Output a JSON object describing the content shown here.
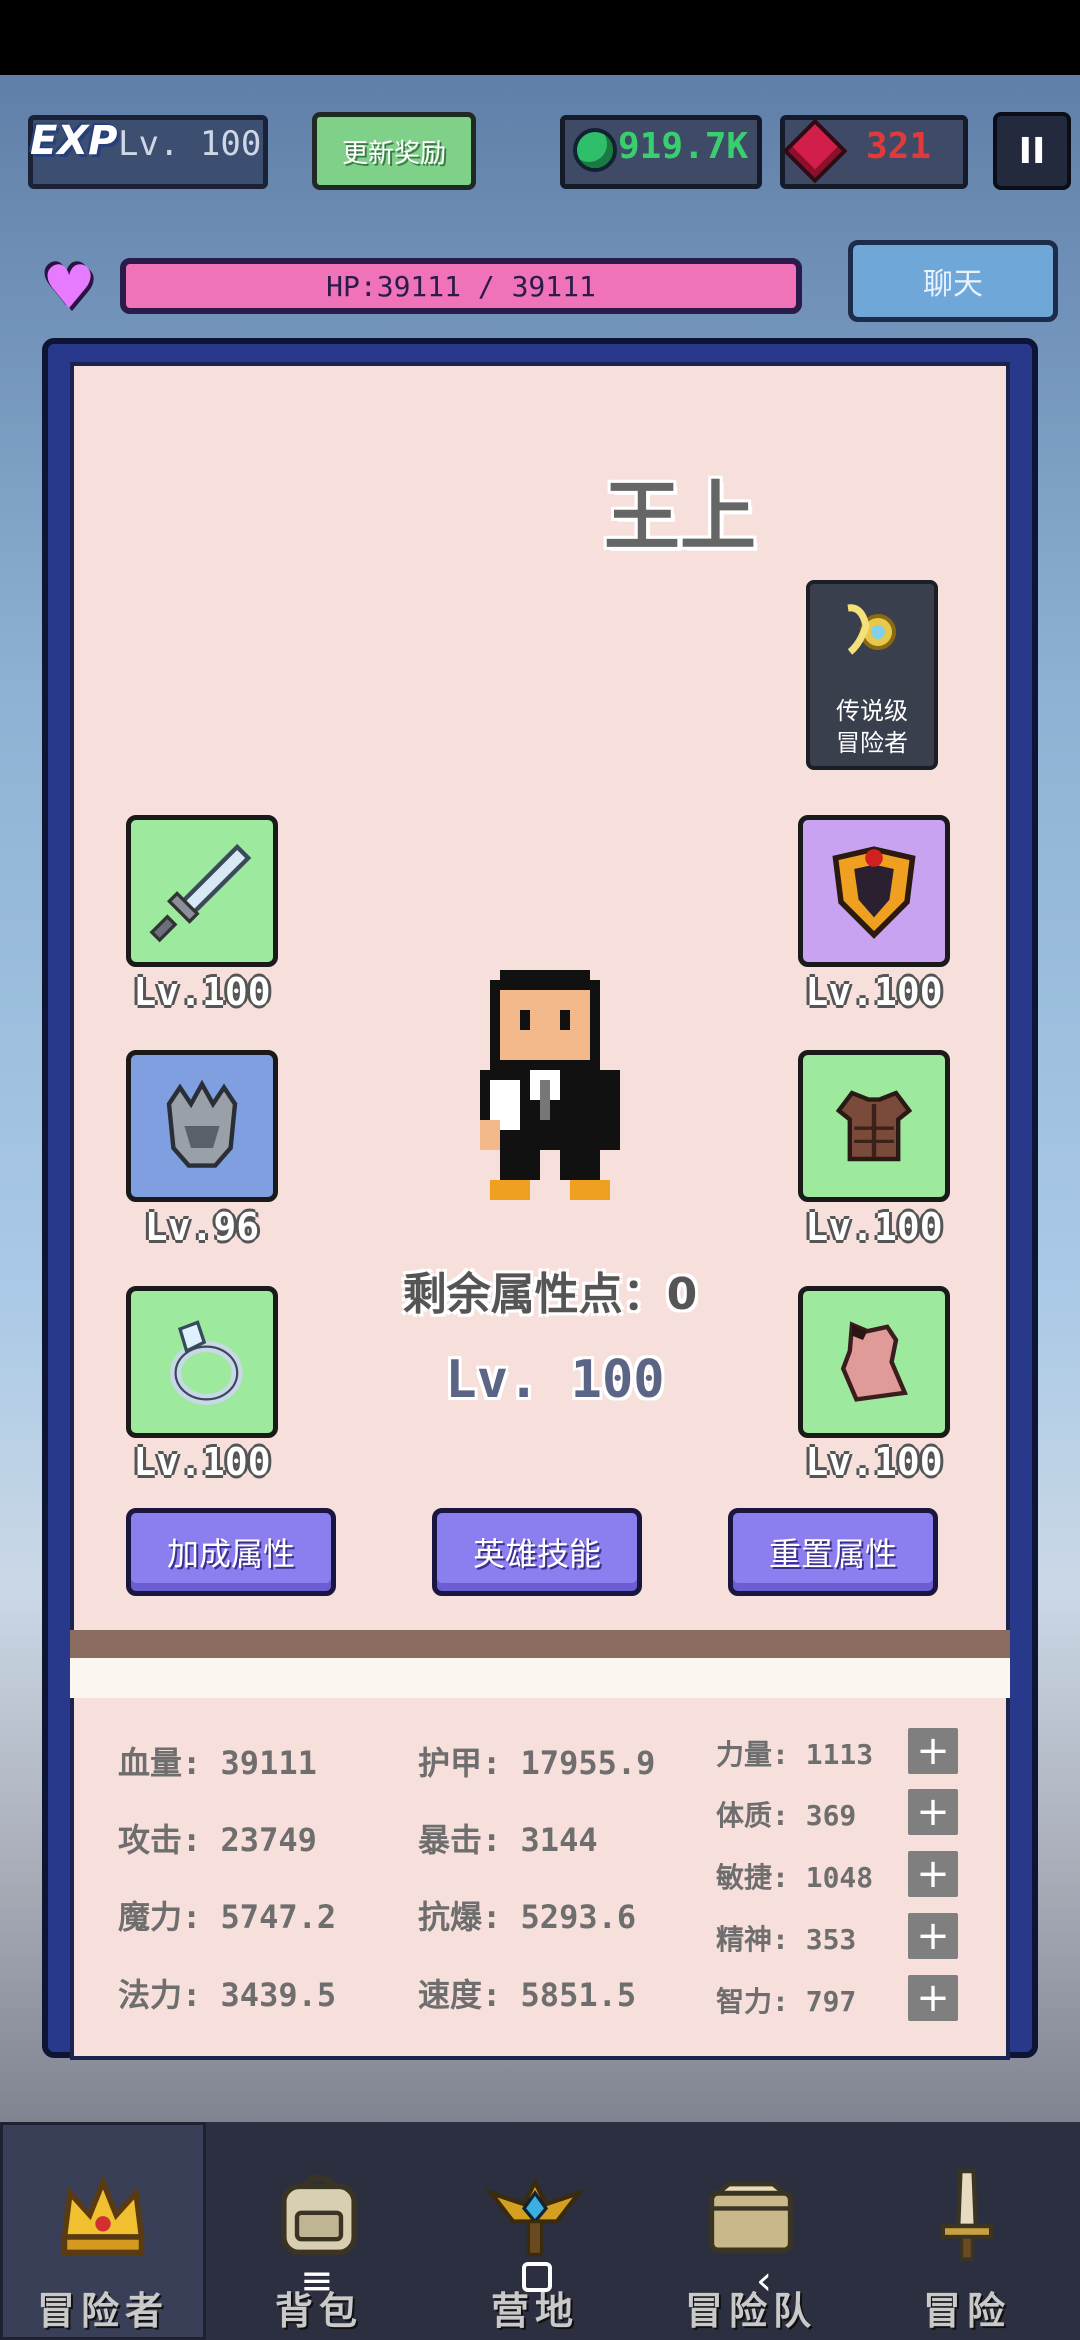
{
  "header": {
    "exp_label": "EXP",
    "level": "Lv. 100",
    "reward_button": "更新奖励",
    "gems_green": "919.7K",
    "gems_red": "321",
    "pause_symbol": "II"
  },
  "hp": {
    "text": "HP:39111 / 39111",
    "fill_fraction": 1.0,
    "chat_button": "聊天"
  },
  "hero": {
    "name": "王上",
    "rank_line1": "传说级",
    "rank_line2": "冒险者",
    "attr_points": "剩余属性点：0",
    "level": "Lv. 100"
  },
  "equipment": [
    {
      "slot": "weapon",
      "icon": "sword-icon",
      "rarity": "green",
      "level": "Lv.100"
    },
    {
      "slot": "helmet",
      "icon": "helmet-icon",
      "rarity": "blue",
      "level": "Lv.96"
    },
    {
      "slot": "ring",
      "icon": "ring-icon",
      "rarity": "green",
      "level": "Lv.100"
    },
    {
      "slot": "shield",
      "icon": "shield-icon",
      "rarity": "purple",
      "level": "Lv.100"
    },
    {
      "slot": "armor",
      "icon": "armor-icon",
      "rarity": "green",
      "level": "Lv.100"
    },
    {
      "slot": "body",
      "icon": "cloth-icon",
      "rarity": "green",
      "level": "Lv.100"
    }
  ],
  "actions": {
    "bonus": "加成属性",
    "skills": "英雄技能",
    "reset": "重置属性"
  },
  "stats": {
    "col1": [
      "血量: 39111",
      "攻击: 23749",
      "魔力: 5747.2",
      "法力: 3439.5"
    ],
    "col2": [
      "护甲: 17955.9",
      "暴击: 3144",
      "抗爆: 5293.6",
      "速度: 5851.5"
    ],
    "col3": [
      "力量: 1113",
      "体质: 369",
      "敏捷: 1048",
      "精神: 353",
      "智力: 797"
    ],
    "plus": "+"
  },
  "nav": [
    {
      "label": "冒险者",
      "icon": "crown-icon"
    },
    {
      "label": "背包",
      "icon": "backpack-icon"
    },
    {
      "label": "营地",
      "icon": "camp-icon"
    },
    {
      "label": "冒险队",
      "icon": "team-chest-icon"
    },
    {
      "label": "冒险",
      "icon": "sword-hilt-icon"
    }
  ],
  "colors": {
    "panel_border": "#28388a",
    "panel_bg": "#f7dfdb",
    "hp_fill": "#f072b8",
    "action_button": "#8b7ff0"
  }
}
